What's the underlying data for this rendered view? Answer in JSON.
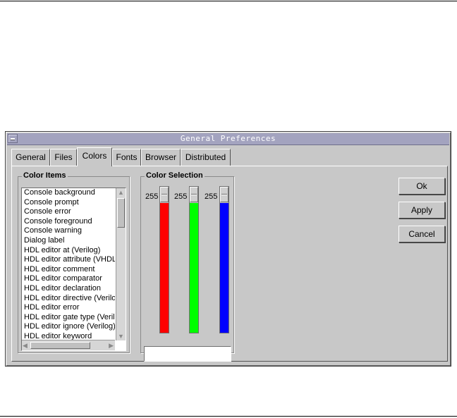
{
  "window": {
    "title": "General Preferences"
  },
  "tabs": [
    "General",
    "Files",
    "Colors",
    "Fonts",
    "Browser",
    "Distributed"
  ],
  "active_tab": "Colors",
  "color_items": {
    "label": "Color Items",
    "items": [
      "Console background",
      "Console prompt",
      "Console error",
      "Console foreground",
      "Console warning",
      "Dialog label",
      "HDL editor at (Verilog)",
      "HDL editor attribute (VHDL)",
      "HDL editor comment",
      "HDL editor comparator",
      "HDL editor declaration",
      "HDL editor directive (Verilog)",
      "HDL editor error",
      "HDL editor gate type (Verilog)",
      "HDL editor ignore (Verilog)",
      "HDL editor keyword"
    ]
  },
  "color_selection": {
    "label": "Color Selection",
    "red": {
      "value": "255",
      "color": "#ff0000"
    },
    "green": {
      "value": "255",
      "color": "#00ff00"
    },
    "blue": {
      "value": "255",
      "color": "#0000ff"
    }
  },
  "buttons": {
    "ok": "Ok",
    "apply": "Apply",
    "cancel": "Cancel"
  },
  "colors": {
    "window_bg": "#c8c8c8",
    "titlebar": "#a3a3bf"
  }
}
